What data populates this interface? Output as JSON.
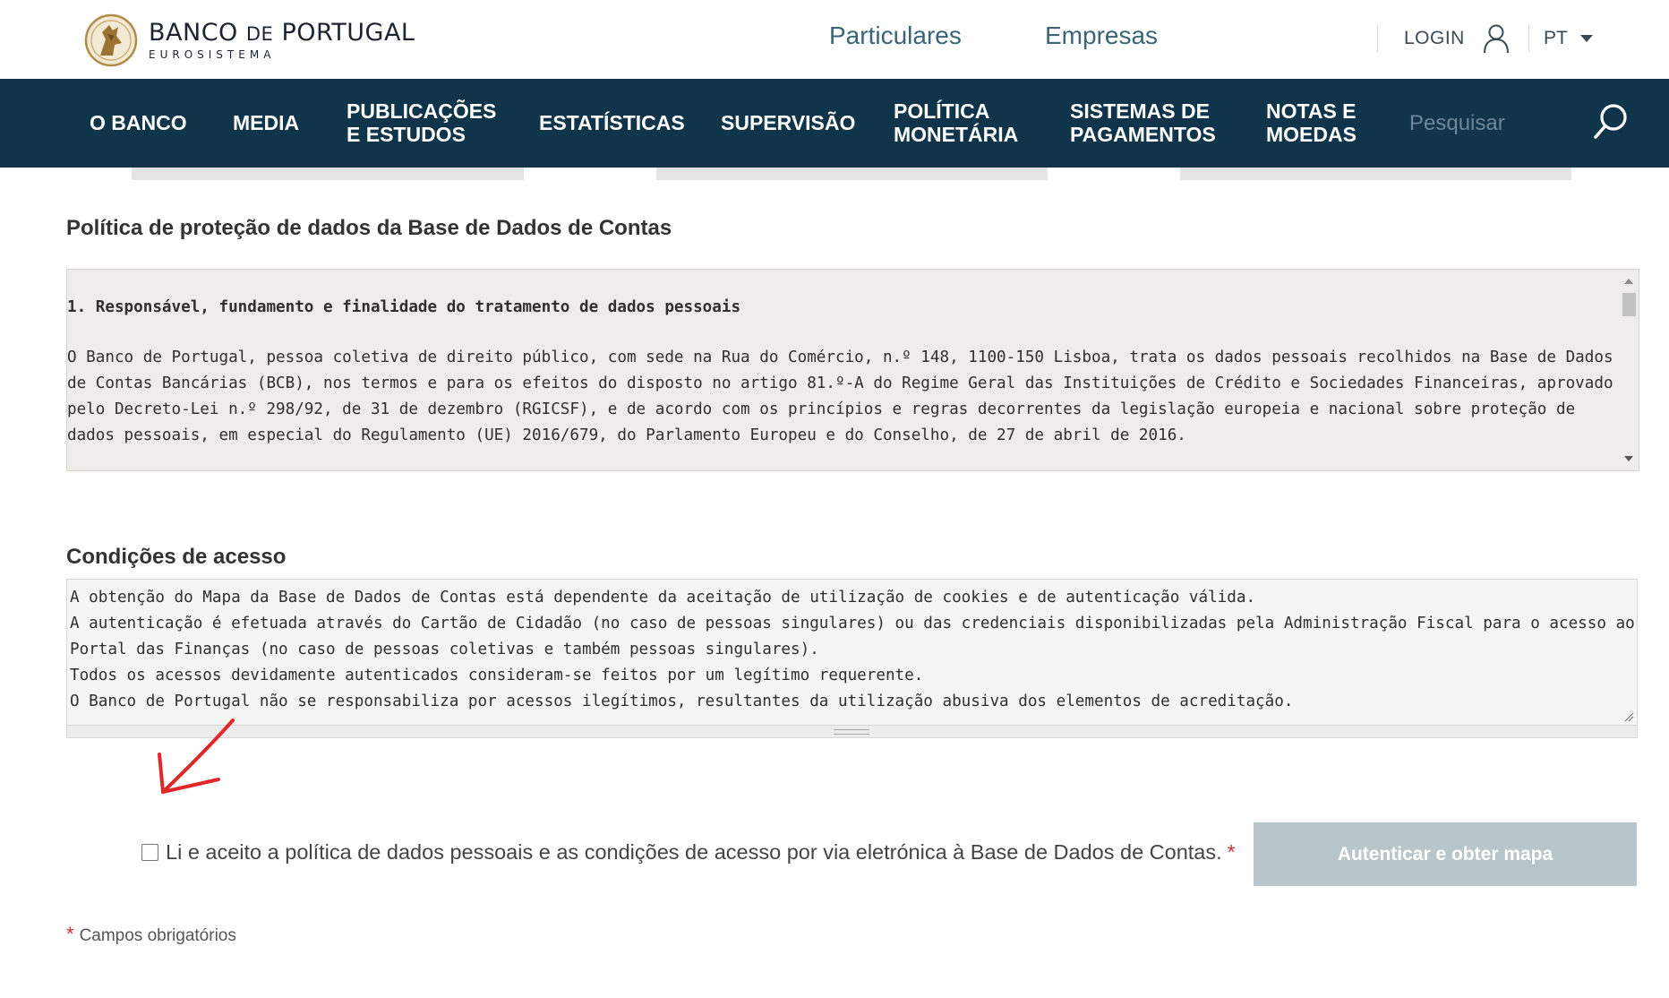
{
  "brand": {
    "name_part1": "BANCO",
    "name_part2": "DE",
    "name_part3": "PORTUGAL",
    "subtitle": "EUROSISTEMA"
  },
  "header": {
    "segments": [
      "Particulares",
      "Empresas"
    ],
    "login_label": "LOGIN",
    "language": "PT"
  },
  "nav": {
    "items": [
      "O BANCO",
      "MEDIA",
      "PUBLICAÇÕES\nE ESTUDOS",
      "ESTATÍSTICAS",
      "SUPERVISÃO",
      "POLÍTICA\nMONETÁRIA",
      "SISTEMAS DE\nPAGAMENTOS",
      "NOTAS E\nMOEDAS"
    ],
    "search_placeholder": "Pesquisar"
  },
  "policy": {
    "title": "Política de proteção de dados da Base de Dados de Contas",
    "section_heading": "1. Responsável, fundamento e finalidade do tratamento de dados pessoais",
    "body": "O Banco de Portugal, pessoa coletiva de direito público, com sede na Rua do Comércio, n.º 148, 1100-150 Lisboa, trata os dados pessoais recolhidos na Base de Dados de Contas Bancárias (BCB), nos termos e para os efeitos do disposto no artigo 81.º-A do Regime Geral das Instituições de Crédito e Sociedades Financeiras, aprovado pelo Decreto-Lei n.º 298/92, de 31 de dezembro (RGICSF), e de acordo com os princípios e regras decorrentes da legislação europeia e nacional sobre proteção de dados pessoais, em especial do Regulamento (UE) 2016/679, do Parlamento Europeu e do Conselho, de 27 de abril de 2016."
  },
  "conditions": {
    "title": "Condições de acesso",
    "lines": [
      "A obtenção do Mapa da Base de Dados de Contas está dependente da aceitação de utilização de cookies e de autenticação válida.",
      "A autenticação é efetuada através do Cartão de Cidadão (no caso de pessoas singulares) ou das credenciais disponibilizadas pela Administração Fiscal para o acesso ao Portal das Finanças (no caso de pessoas coletivas e também pessoas singulares).",
      "Todos os acessos devidamente autenticados consideram-se feitos por um legítimo requerente.",
      "O Banco de Portugal não se responsabiliza por acessos ilegítimos, resultantes da utilização abusiva dos elementos de acreditação."
    ]
  },
  "consent": {
    "label": "Li e aceito a política de dados pessoais e as condições de acesso por via eletrónica à Base de Dados de Contas.",
    "required_marker": "*",
    "checked": false
  },
  "actions": {
    "authenticate_label": "Autenticar e obter mapa"
  },
  "footer": {
    "required_marker": "*",
    "required_note": "Campos obrigatórios"
  },
  "colors": {
    "nav_background": "#103449",
    "segment_link": "#3b6478",
    "button_disabled": "#b8c5cb",
    "required": "#d32f2f",
    "annotation_arrow": "#e0282b"
  }
}
